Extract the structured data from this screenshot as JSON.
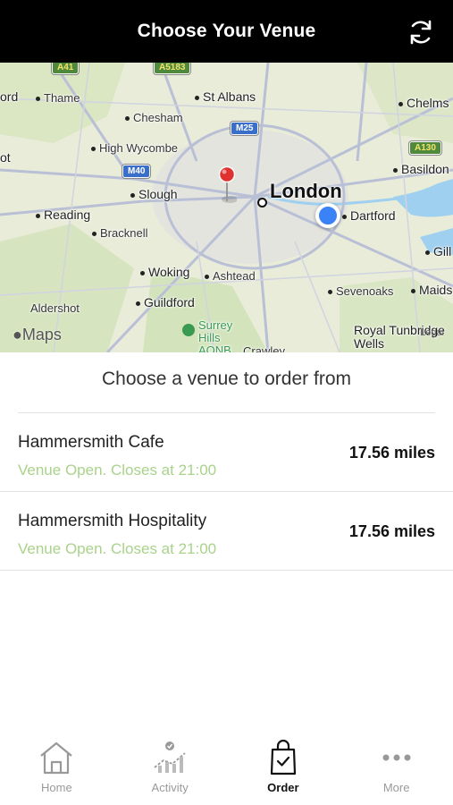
{
  "header": {
    "title": "Choose Your Venue",
    "refresh_icon": "refresh-icon"
  },
  "map": {
    "places": {
      "thame": "Thame",
      "st_albans": "St Albans",
      "chelmsford": "Chelms",
      "chesham": "Chesham",
      "high_wycombe": "High Wycombe",
      "basildon": "Basildon",
      "slough": "Slough",
      "london": "London",
      "reading": "Reading",
      "dartford": "Dartford",
      "bracknell": "Bracknell",
      "gill": "Gill",
      "woking": "Woking",
      "ashtead": "Ashtead",
      "guildford": "Guildford",
      "sevenoaks": "Sevenoaks",
      "maidstone": "Maids",
      "aldershot": "Aldershot",
      "surrey_hills": "Surrey Hills AONB",
      "royal_tunbridge": "Royal Tunbridge Wells",
      "crawley": "Crawley",
      "oxford_left": "ord",
      "left_edge": "ot"
    },
    "road_shields": {
      "a41": "A41",
      "a5183": "A5183",
      "m25": "M25",
      "m40": "M40",
      "a130": "A130"
    },
    "attribution": "Maps",
    "legal": "Legal"
  },
  "subtitle": "Choose a venue to order from",
  "venues": [
    {
      "name": "Hammersmith Cafe",
      "status": "Venue Open. Closes at 21:00",
      "distance": "17.56 miles"
    },
    {
      "name": "Hammersmith Hospitality",
      "status": "Venue Open. Closes at 21:00",
      "distance": "17.56 miles"
    }
  ],
  "tabs": [
    {
      "label": "Home",
      "icon": "home-icon",
      "active": false
    },
    {
      "label": "Activity",
      "icon": "activity-icon",
      "active": false
    },
    {
      "label": "Order",
      "icon": "shopping-bag-icon",
      "active": true
    },
    {
      "label": "More",
      "icon": "more-icon",
      "active": false
    }
  ],
  "colors": {
    "header_bg": "#000000",
    "status_open": "#a9d28a",
    "user_location": "#3b82f6",
    "pin": "#e03131"
  }
}
